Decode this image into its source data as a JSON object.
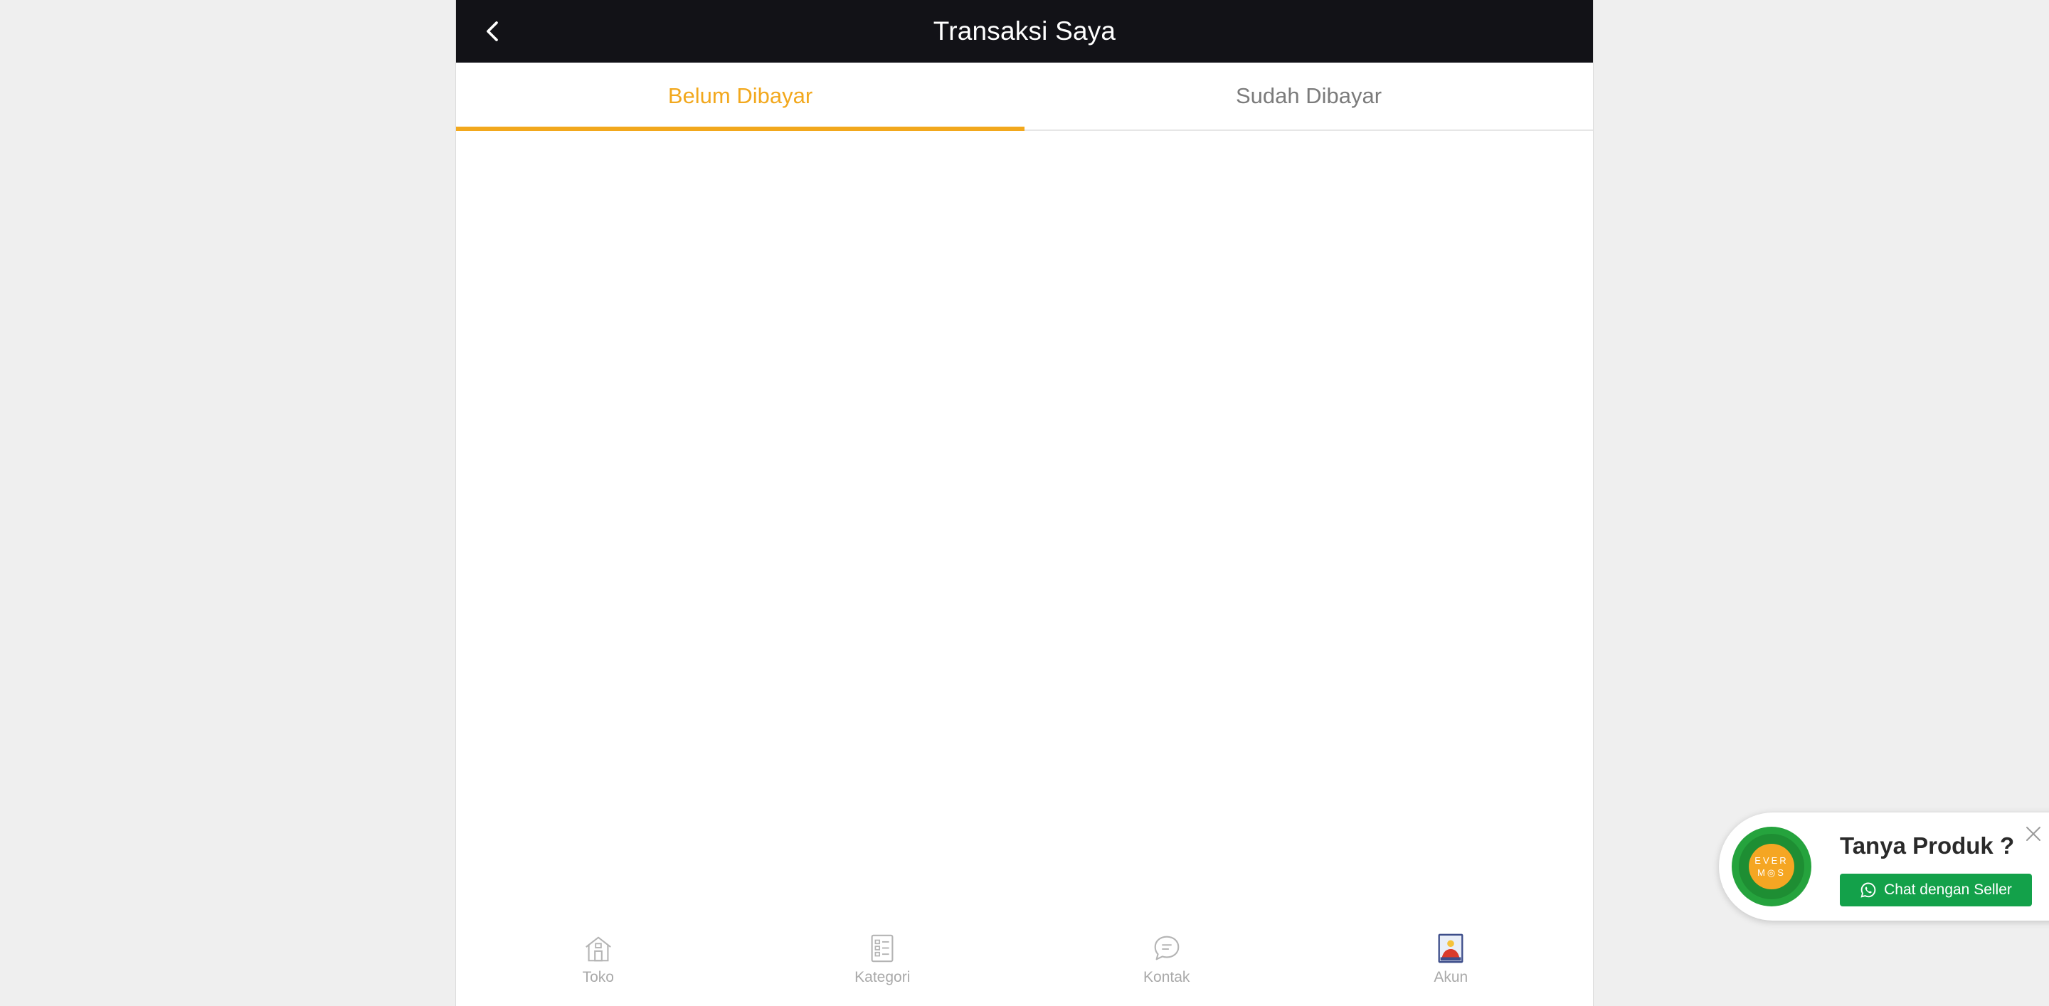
{
  "header": {
    "title": "Transaksi Saya",
    "back_icon": "chevron-left-icon"
  },
  "tabs": [
    {
      "label": "Belum Dibayar",
      "active": true
    },
    {
      "label": "Sudah Dibayar",
      "active": false
    }
  ],
  "bottom_nav": [
    {
      "label": "Toko",
      "icon": "store-icon"
    },
    {
      "label": "Kategori",
      "icon": "list-icon"
    },
    {
      "label": "Kontak",
      "icon": "chat-bubble-icon"
    },
    {
      "label": "Akun",
      "icon": "account-icon"
    }
  ],
  "chat_widget": {
    "logo_text_top": "EVER",
    "logo_text_bottom": "M◎S",
    "title": "Tanya Produk ?",
    "button_label": "Chat dengan Seller",
    "button_icon": "whatsapp-icon",
    "close_icon": "close-icon"
  },
  "colors": {
    "accent": "#f2a81d",
    "header_bg": "#121217",
    "whatsapp_green": "#13a14a",
    "page_bg": "#efefef"
  }
}
